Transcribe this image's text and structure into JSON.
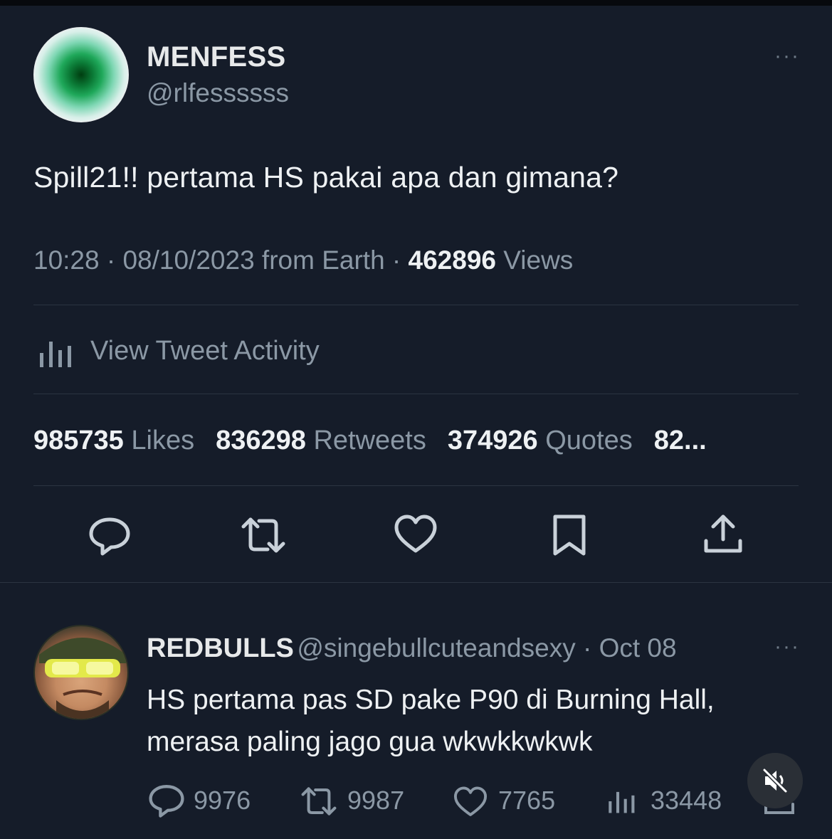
{
  "tweet": {
    "author_name": "MENFESS",
    "author_handle": "@rlfessssss",
    "more": "···",
    "text": "Spill21!! pertama HS pakai apa dan gimana?",
    "time": "10:28 · 08/10/2023 from Earth · ",
    "views_count": "462896",
    "views_label": " Views",
    "activity_label": "View Tweet Activity",
    "stats": [
      {
        "count": "985735",
        "label": " Likes"
      },
      {
        "count": "836298",
        "label": " Retweets"
      },
      {
        "count": "374926",
        "label": " Quotes"
      },
      {
        "count": "82...",
        "label": ""
      }
    ],
    "actions": [
      "reply-icon",
      "retweet-icon",
      "like-icon",
      "bookmark-icon",
      "share-icon"
    ]
  },
  "reply": {
    "author_name": "REDBULLS",
    "author_handle": "@singebullcuteandsexy · Oct 08",
    "more": "···",
    "text_line1": "HS pertama pas SD pake P90 di Burning Hall,",
    "text_line2": "merasa paling jago gua wkwkkwkwk",
    "replies": "9976",
    "retweets": "9987",
    "likes": "7765",
    "views": "33448"
  },
  "colors": {
    "background": "#151c29",
    "text": "#eef1f3",
    "muted": "#8b98a5"
  }
}
